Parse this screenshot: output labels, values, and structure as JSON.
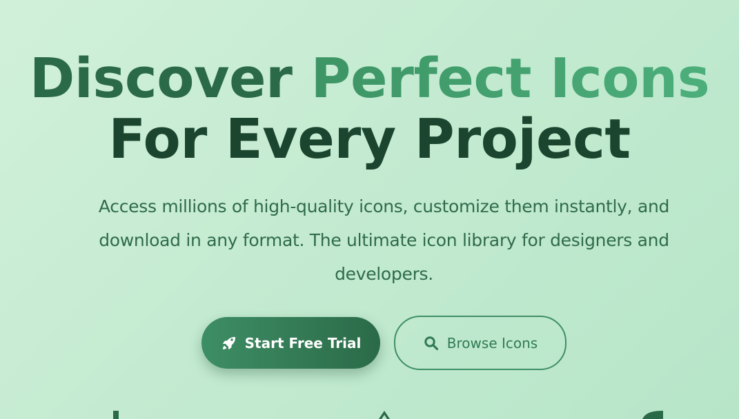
{
  "hero": {
    "headline_word1": "Discover",
    "headline_accent": "Perfect Icons",
    "headline_line2": "For Every Project",
    "subtitle": "Access millions of high-quality icons, customize them instantly, and download in any format. The ultimate icon library for designers and developers."
  },
  "cta": {
    "primary_label": "Start Free Trial",
    "primary_icon": "rocket-icon",
    "secondary_label": "Browse Icons",
    "secondary_icon": "search-icon"
  },
  "colors": {
    "primary_green": "#2b6a48",
    "accent_green": "#4caf7b",
    "dark_text": "#1c4530",
    "background": "#c4ebd1"
  }
}
